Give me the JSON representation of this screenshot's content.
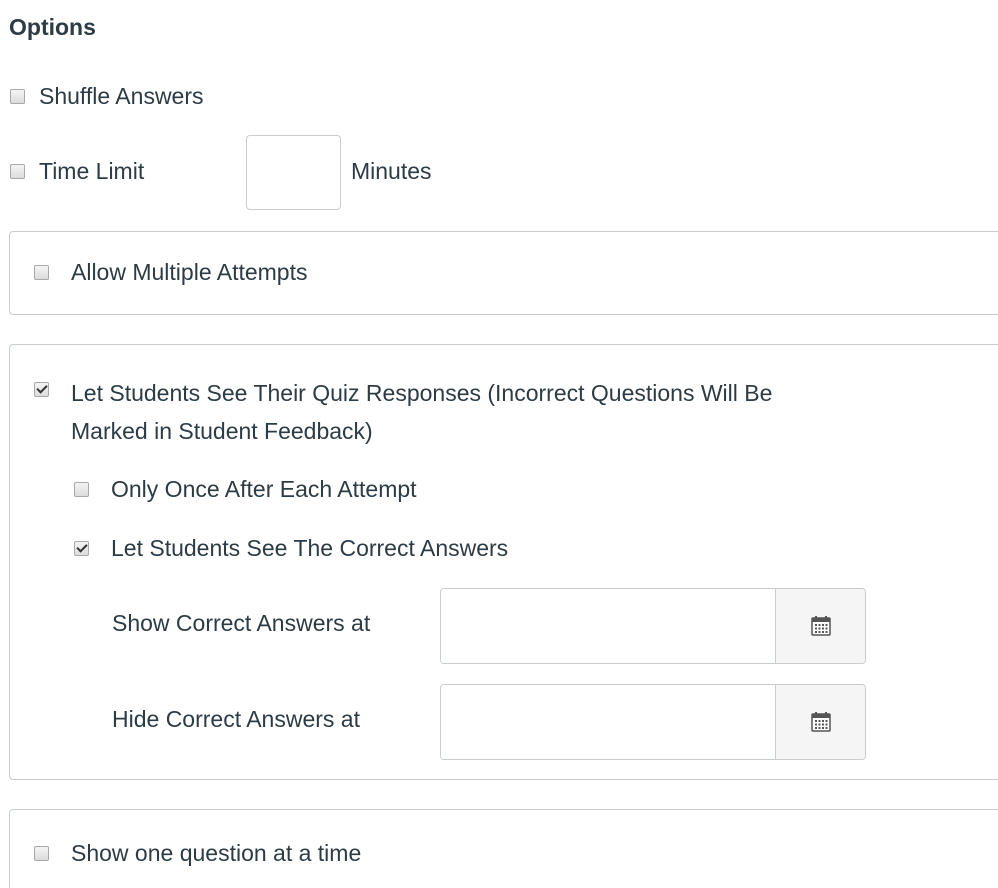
{
  "options": {
    "heading": "Options",
    "shuffle_answers": {
      "label": "Shuffle Answers",
      "checked": false
    },
    "time_limit": {
      "label": "Time Limit",
      "value": "",
      "unit": "Minutes",
      "checked": false
    },
    "allow_multiple_attempts": {
      "label": "Allow Multiple Attempts",
      "checked": false
    },
    "see_responses": {
      "label_line1": "Let Students See Their Quiz Responses (Incorrect Questions Will Be",
      "label_line2": "Marked in Student Feedback)",
      "checked": true,
      "only_once": {
        "label": "Only Once After Each Attempt",
        "checked": false
      },
      "see_correct": {
        "label": "Let Students See The Correct Answers",
        "checked": true
      },
      "show_correct_at": {
        "label": "Show Correct Answers at",
        "value": "",
        "icon": "calendar-icon"
      },
      "hide_correct_at": {
        "label": "Hide Correct Answers at",
        "value": "",
        "icon": "calendar-icon"
      }
    },
    "one_question_at_a_time": {
      "label": "Show one question at a time",
      "checked": false
    }
  }
}
